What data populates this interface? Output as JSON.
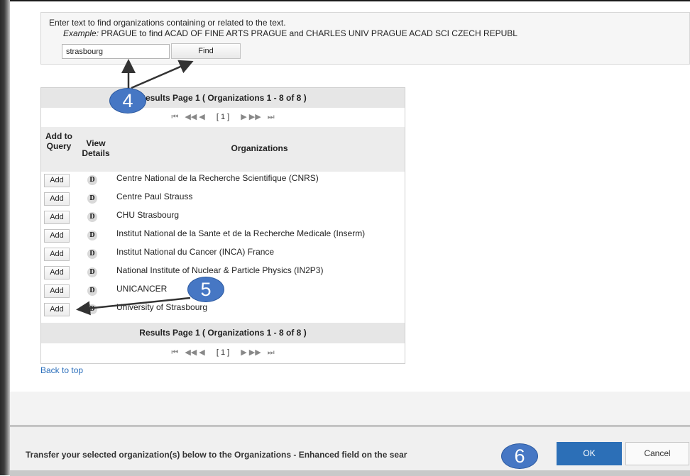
{
  "search": {
    "instruction": "Enter text to find organizations containing or related to the text.",
    "example_label": "Example:",
    "example_text": "PRAGUE to find ACAD OF FINE ARTS PRAGUE and CHARLES UNIV PRAGUE ACAD SCI CZECH REPUBL",
    "input_value": "strasbourg",
    "find_label": "Find"
  },
  "results": {
    "header": "Results Page 1 ( Organizations 1 - 8 of 8 )",
    "pager_page": "[ 1 ]",
    "col_add": "Add to Query",
    "col_view": "View Details",
    "col_org": "Organizations",
    "add_label": "Add",
    "details_label": "D",
    "rows": [
      {
        "name": "Centre National de la Recherche Scientifique (CNRS)"
      },
      {
        "name": "Centre Paul Strauss"
      },
      {
        "name": "CHU Strasbourg"
      },
      {
        "name": "Institut National de la Sante et de la Recherche Medicale (Inserm)"
      },
      {
        "name": "Institut National du Cancer (INCA) France"
      },
      {
        "name": "National Institute of Nuclear & Particle Physics (IN2P3)"
      },
      {
        "name": "UNICANCER"
      },
      {
        "name": "University of Strasbourg"
      }
    ],
    "footer": "Results Page 1 ( Organizations 1 - 8 of 8 )"
  },
  "back_to_top": "Back to top",
  "bottom": {
    "transfer_text": "Transfer your selected organization(s) below to the Organizations - Enhanced field on the sear",
    "ok_label": "OK",
    "cancel_label": "Cancel"
  },
  "callouts": {
    "c4": "4",
    "c5": "5",
    "c6": "6"
  },
  "colors": {
    "callout": "#4677c4",
    "ok_button": "#2c6fb7",
    "link": "#2a6ebb"
  },
  "icons": [
    "first-page-icon",
    "prev-page-icon",
    "next-page-icon",
    "last-page-icon",
    "details-icon"
  ]
}
